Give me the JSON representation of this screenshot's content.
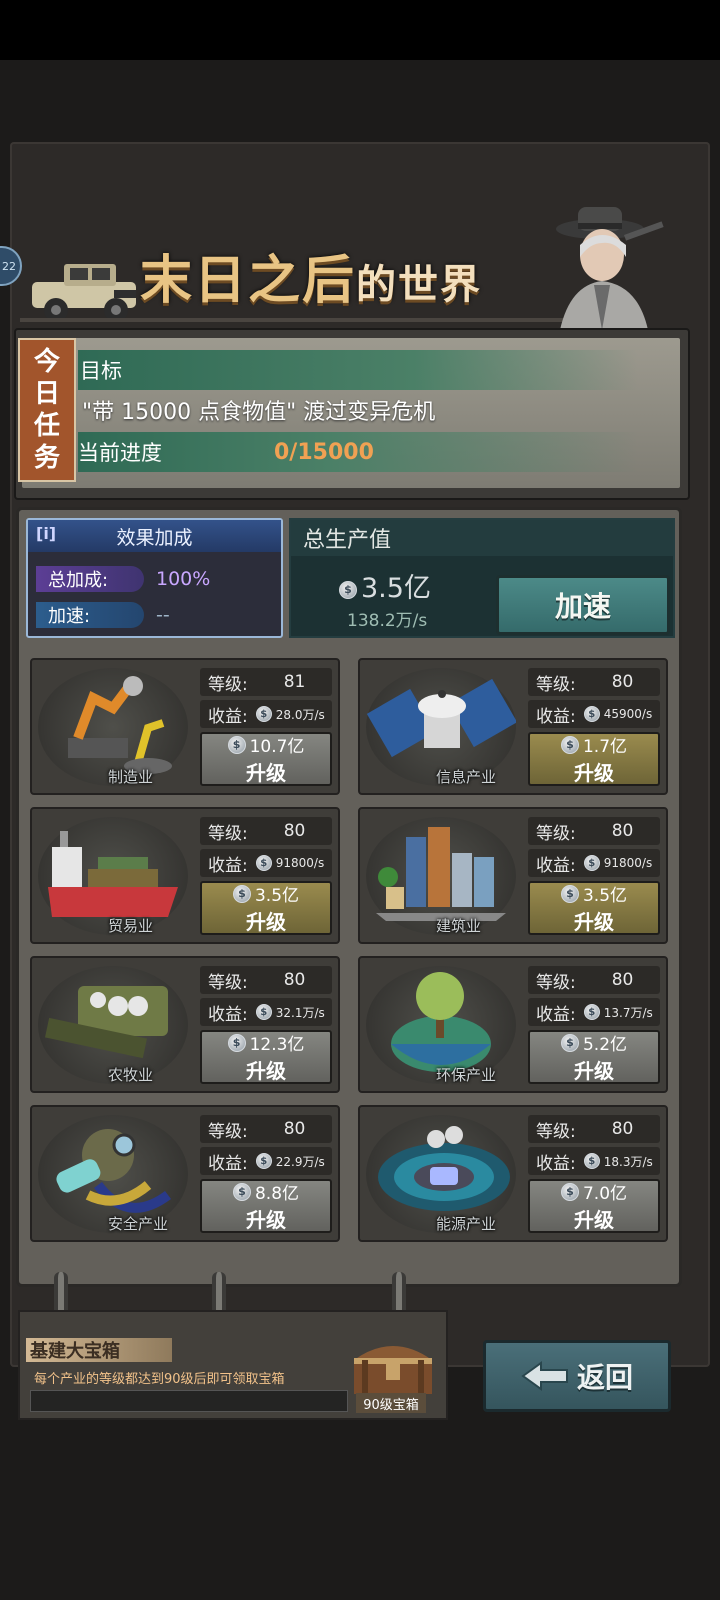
{
  "side_badge": "22",
  "header": {
    "title_main": "末日之后",
    "title_tail": "的世界"
  },
  "task": {
    "tag_chars": [
      "今",
      "日",
      "任",
      "务"
    ],
    "goal_label": "目标",
    "goal_text": "\"带 15000 点食物值\" 渡过变异危机",
    "progress_label": "当前进度",
    "progress_value": "0/15000"
  },
  "effect": {
    "info_icon": "[i]",
    "title": "效果加成",
    "total_label": "总加成:",
    "total_value": "100%",
    "speed_label": "加速:",
    "speed_value": "--"
  },
  "production": {
    "title": "总生产值",
    "value": "3.5亿",
    "rate": "138.2万/s",
    "speed_button": "加速"
  },
  "industries": [
    {
      "name": "制造业",
      "level_label": "等级:",
      "level": "81",
      "income_label": "收益:",
      "income": "28.0万/s",
      "cost": "10.7亿",
      "upgrade": "升级",
      "style": "gray"
    },
    {
      "name": "信息产业",
      "level_label": "等级:",
      "level": "80",
      "income_label": "收益:",
      "income": "45900/s",
      "cost": "1.7亿",
      "upgrade": "升级",
      "style": "gold"
    },
    {
      "name": "贸易业",
      "level_label": "等级:",
      "level": "80",
      "income_label": "收益:",
      "income": "91800/s",
      "cost": "3.5亿",
      "upgrade": "升级",
      "style": "gold"
    },
    {
      "name": "建筑业",
      "level_label": "等级:",
      "level": "80",
      "income_label": "收益:",
      "income": "91800/s",
      "cost": "3.5亿",
      "upgrade": "升级",
      "style": "gold"
    },
    {
      "name": "农牧业",
      "level_label": "等级:",
      "level": "80",
      "income_label": "收益:",
      "income": "32.1万/s",
      "cost": "12.3亿",
      "upgrade": "升级",
      "style": "gray"
    },
    {
      "name": "环保产业",
      "level_label": "等级:",
      "level": "80",
      "income_label": "收益:",
      "income": "13.7万/s",
      "cost": "5.2亿",
      "upgrade": "升级",
      "style": "gray"
    },
    {
      "name": "安全产业",
      "level_label": "等级:",
      "level": "80",
      "income_label": "收益:",
      "income": "22.9万/s",
      "cost": "8.8亿",
      "upgrade": "升级",
      "style": "gray"
    },
    {
      "name": "能源产业",
      "level_label": "等级:",
      "level": "80",
      "income_label": "收益:",
      "income": "18.3万/s",
      "cost": "7.0亿",
      "upgrade": "升级",
      "style": "gray"
    }
  ],
  "chest": {
    "title": "基建大宝箱",
    "desc": "每个产业的等级都达到90级后即可领取宝箱",
    "label": "90级宝箱"
  },
  "back_button": "返回",
  "colors": {
    "accent_gold": "#e8c484",
    "progress_orange": "#f0a153",
    "effect_purple": "#c9a7ff"
  }
}
